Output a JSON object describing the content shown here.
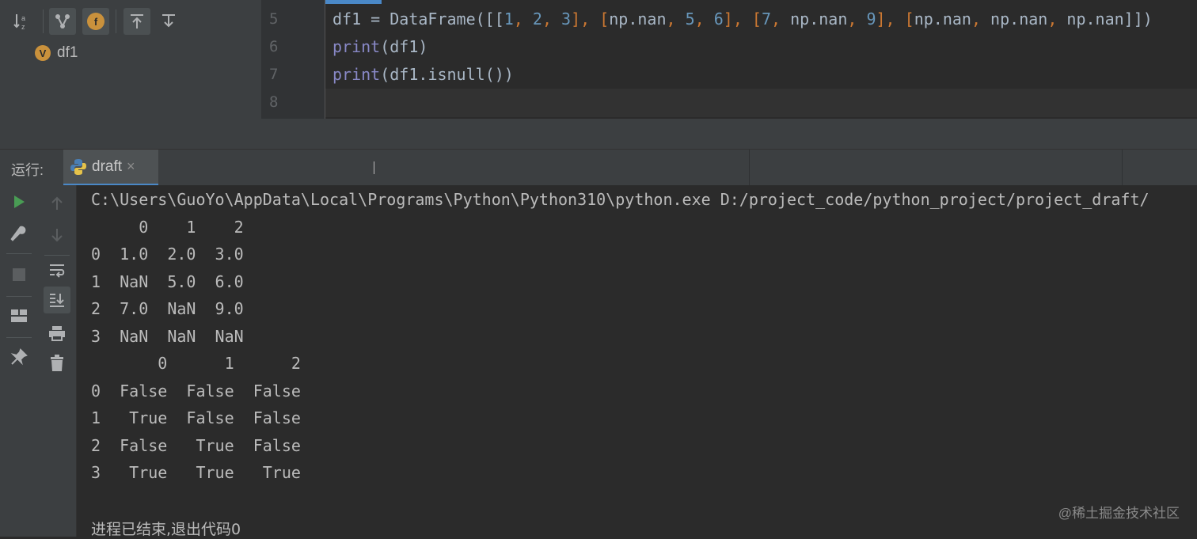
{
  "structure": {
    "toolbar": {
      "sort_alpha_icon": "sort-alphabetically-icon",
      "show_inherited_icon": "show-inherited-icon",
      "show_fields_label": "f",
      "expand_all_icon": "expand-all-icon",
      "collapse_all_icon": "collapse-all-icon"
    },
    "items": [
      {
        "badge": "V",
        "label": "df1"
      }
    ]
  },
  "editor": {
    "lines": [
      {
        "number": "5",
        "code": "df1 = DataFrame([[1, 2, 3], [np.nan, 5, 6], [7, np.nan, 9], [np.nan, np.nan, np.nan]])"
      },
      {
        "number": "6",
        "code": "print(df1)"
      },
      {
        "number": "7",
        "code": "print(df1.isnull())"
      },
      {
        "number": "8",
        "code": ""
      }
    ]
  },
  "run_panel": {
    "label": "运行:",
    "tab": {
      "name": "draft",
      "close": "×"
    }
  },
  "console": {
    "lines": [
      "C:\\Users\\GuoYo\\AppData\\Local\\Programs\\Python\\Python310\\python.exe D:/project_code/python_project/project_draft/",
      "     0    1    2",
      "0  1.0  2.0  3.0",
      "1  NaN  5.0  6.0",
      "2  7.0  NaN  9.0",
      "3  NaN  NaN  NaN",
      "       0      1      2",
      "0  False  False  False",
      "1   True  False  False",
      "2  False   True  False",
      "3   True   True   True"
    ],
    "exit_message": "进程已结束,退出代码0",
    "watermark": "@稀土掘金技术社区"
  },
  "colors": {
    "accent": "#4a88c7",
    "run_green": "#499c54",
    "keyword_purple": "#9876aa",
    "number_blue": "#6897bb",
    "builtin_blue": "#8888c6",
    "badge_orange": "#c9913c"
  }
}
